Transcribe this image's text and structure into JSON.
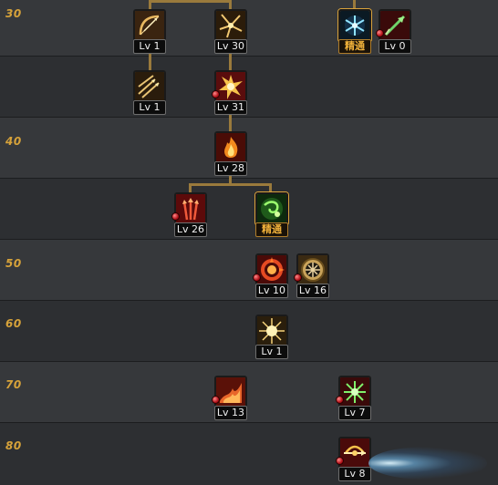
{
  "tiers": [
    {
      "label": "30"
    },
    {
      "label": ""
    },
    {
      "label": "40"
    },
    {
      "label": ""
    },
    {
      "label": "50"
    },
    {
      "label": "60"
    },
    {
      "label": "70"
    },
    {
      "label": "80"
    }
  ],
  "skills": {
    "s_bow": {
      "name": "bow-skill-icon",
      "level": "Lv 1",
      "icon": "bow"
    },
    "s_arrows": {
      "name": "arrow-burst-skill-icon",
      "level": "Lv 30",
      "icon": "burst-arrows"
    },
    "s_frost": {
      "name": "frost-mastery-icon",
      "level": "精通",
      "icon": "frost-snowflake",
      "mastery": true
    },
    "s_green_arrow": {
      "name": "green-arrow-skill-icon",
      "level": "Lv 0",
      "icon": "green-arrow"
    },
    "s_multishot": {
      "name": "multishot-skill-icon",
      "level": "Lv 1",
      "icon": "multishot"
    },
    "s_explosion": {
      "name": "explosion-skill-icon",
      "level": "Lv 31",
      "icon": "explosion"
    },
    "s_flame": {
      "name": "flame-skill-icon",
      "level": "Lv 28",
      "icon": "flame"
    },
    "s_red_arrows": {
      "name": "red-arrows-skill-icon",
      "level": "Lv 26",
      "icon": "red-arrows"
    },
    "s_green_mastery": {
      "name": "green-mastery-icon",
      "level": "精通",
      "icon": "green-swirl",
      "mastery": true
    },
    "s_fire_ring": {
      "name": "fire-ring-skill-icon",
      "level": "Lv 10",
      "icon": "fire-ring"
    },
    "s_compass": {
      "name": "compass-skill-icon",
      "level": "Lv 16",
      "icon": "compass"
    },
    "s_starburst": {
      "name": "starburst-skill-icon",
      "level": "Lv 1",
      "icon": "starburst"
    },
    "s_fire_wave": {
      "name": "fire-wave-skill-icon",
      "level": "Lv 13",
      "icon": "fire-wave"
    },
    "s_green_burst": {
      "name": "green-burst-skill-icon",
      "level": "Lv 7",
      "icon": "green-burst"
    },
    "s_golden_bow": {
      "name": "golden-bow-skill-icon",
      "level": "Lv 8",
      "icon": "golden-bow"
    }
  },
  "colors": {
    "tier_label": "#d6a23a",
    "connector": "#9a7a3c",
    "mastery_text": "#f0b13a",
    "level_text": "#f0f0f0"
  }
}
